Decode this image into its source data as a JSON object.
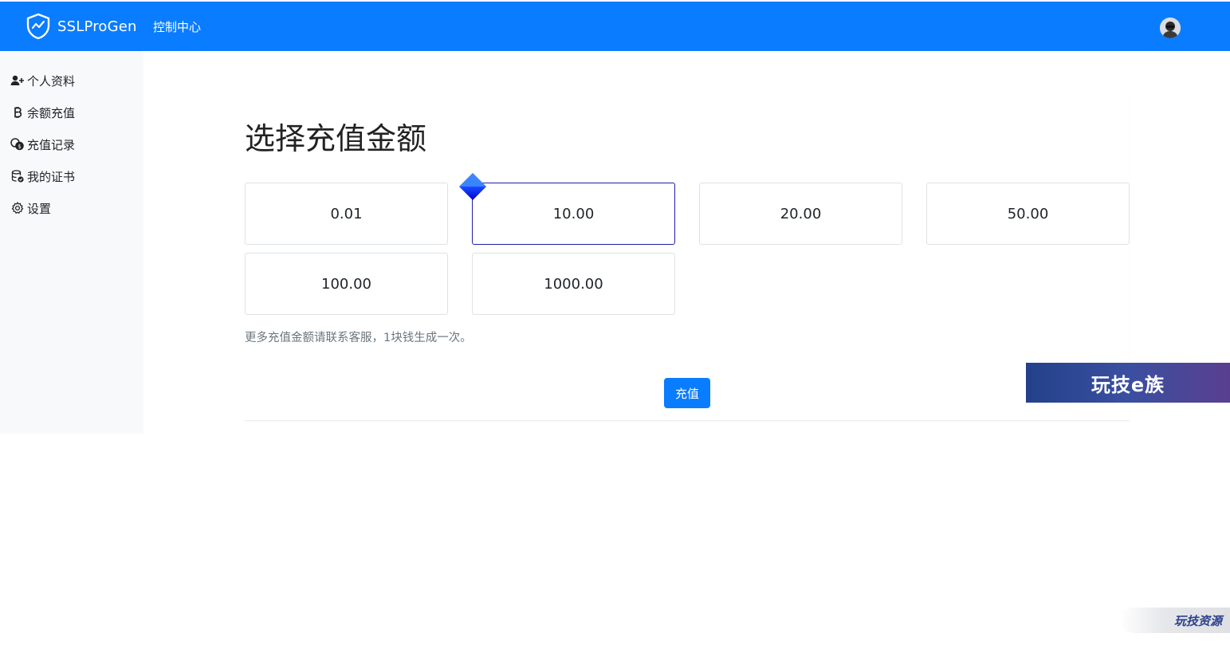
{
  "navbar": {
    "brand": "SSLProGen",
    "nav_link": "控制中心",
    "brand_icon": "shield-icon",
    "avatar_icon": "user-avatar"
  },
  "sidebar": {
    "items": [
      {
        "label": "个人资料",
        "icon": "user-plus-icon"
      },
      {
        "label": "余额充值",
        "icon": "bitcoin-icon"
      },
      {
        "label": "充值记录",
        "icon": "coins-icon"
      },
      {
        "label": "我的证书",
        "icon": "database-check-icon"
      },
      {
        "label": "设置",
        "icon": "gear-icon"
      }
    ]
  },
  "main": {
    "title": "选择充值金额",
    "amounts": [
      "0.01",
      "10.00",
      "20.00",
      "50.00",
      "100.00",
      "1000.00"
    ],
    "selected_amount": "10.00",
    "hint": "更多充值金额请联系客服，1块钱生成一次。",
    "submit_label": "充值"
  },
  "watermarks": {
    "banner": "玩技e族",
    "corner": "玩技资源"
  },
  "colors": {
    "primary": "#0a7cff",
    "selected_border": "#1f1fa8",
    "sidebar_bg": "#f8f9fb"
  }
}
